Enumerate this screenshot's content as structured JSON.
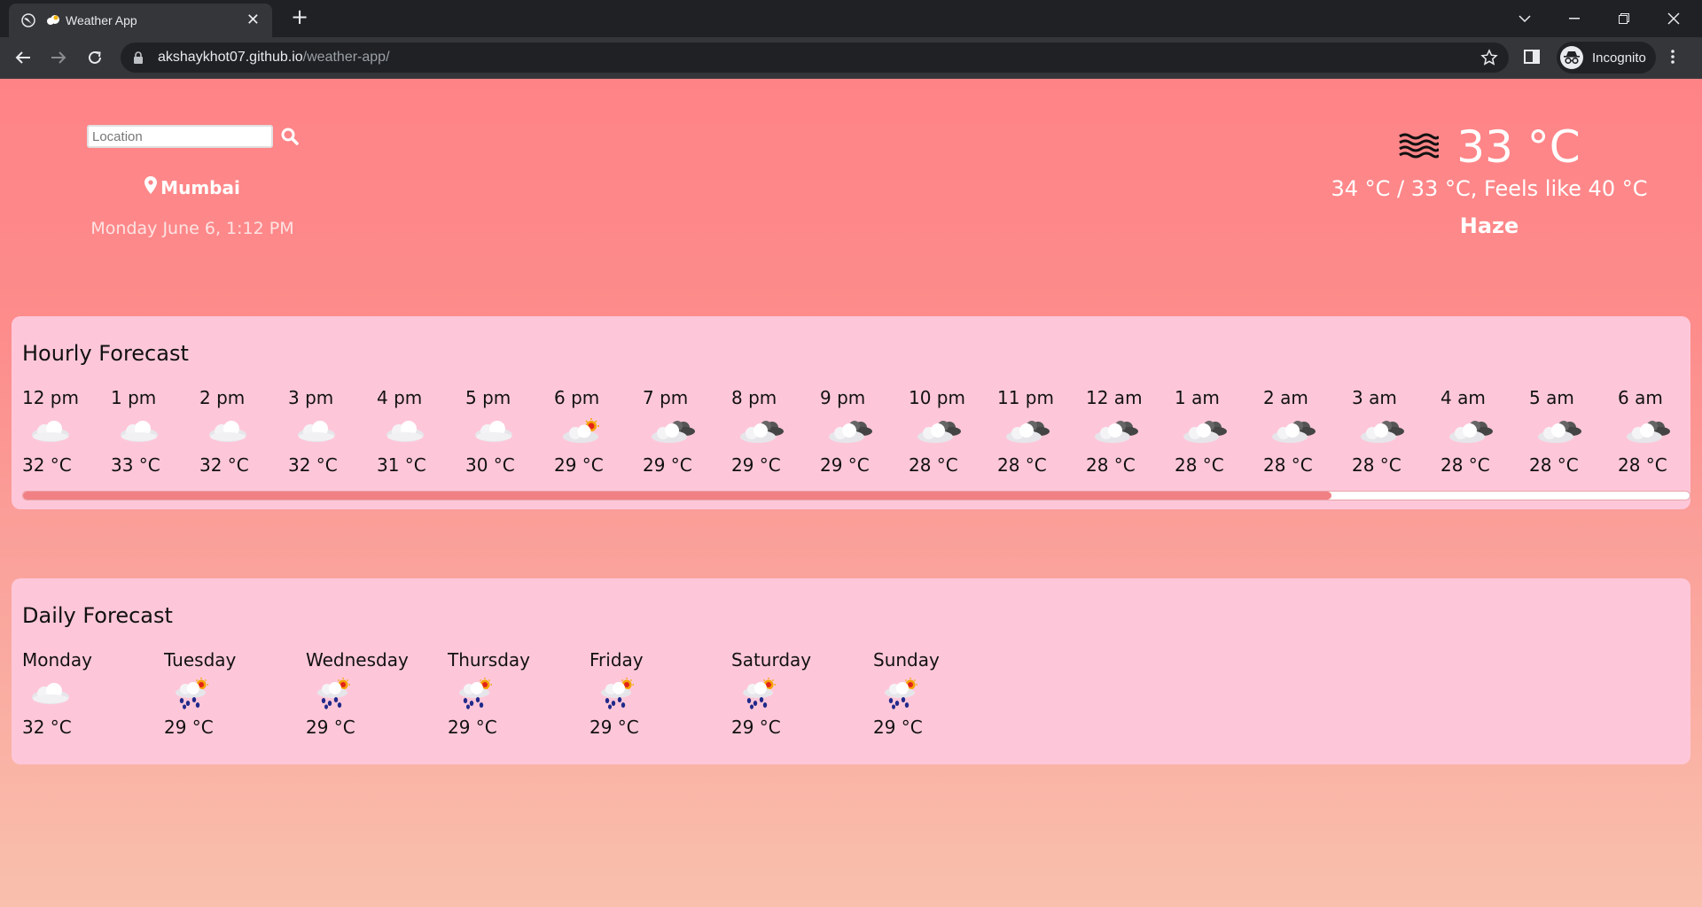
{
  "browser": {
    "tab_title": "Weather App",
    "url_host": "akshaykhot07.github.io",
    "url_path": "/weather-app/",
    "profile_label": "Incognito"
  },
  "search": {
    "placeholder": "Location",
    "value": ""
  },
  "location": {
    "city": "Mumbai",
    "datetime": "Monday June 6, 1:12 PM"
  },
  "current": {
    "temp": "33 °C",
    "range": "34 °C / 33 °C, Feels like 40 °C",
    "condition": "Haze",
    "icon": "haze-icon"
  },
  "hourly": {
    "title": "Hourly Forecast",
    "items": [
      {
        "time": "12 pm",
        "icon": "cloud",
        "temp": "32 °C"
      },
      {
        "time": "1 pm",
        "icon": "cloud",
        "temp": "33 °C"
      },
      {
        "time": "2 pm",
        "icon": "cloud",
        "temp": "32 °C"
      },
      {
        "time": "3 pm",
        "icon": "cloud",
        "temp": "32 °C"
      },
      {
        "time": "4 pm",
        "icon": "cloud",
        "temp": "31 °C"
      },
      {
        "time": "5 pm",
        "icon": "cloud",
        "temp": "30 °C"
      },
      {
        "time": "6 pm",
        "icon": "sun-cloud",
        "temp": "29 °C"
      },
      {
        "time": "7 pm",
        "icon": "dark-cloud",
        "temp": "29 °C"
      },
      {
        "time": "8 pm",
        "icon": "dark-cloud",
        "temp": "29 °C"
      },
      {
        "time": "9 pm",
        "icon": "dark-cloud",
        "temp": "29 °C"
      },
      {
        "time": "10 pm",
        "icon": "dark-cloud",
        "temp": "28 °C"
      },
      {
        "time": "11 pm",
        "icon": "dark-cloud",
        "temp": "28 °C"
      },
      {
        "time": "12 am",
        "icon": "dark-cloud",
        "temp": "28 °C"
      },
      {
        "time": "1 am",
        "icon": "dark-cloud",
        "temp": "28 °C"
      },
      {
        "time": "2 am",
        "icon": "dark-cloud",
        "temp": "28 °C"
      },
      {
        "time": "3 am",
        "icon": "dark-cloud",
        "temp": "28 °C"
      },
      {
        "time": "4 am",
        "icon": "dark-cloud",
        "temp": "28 °C"
      },
      {
        "time": "5 am",
        "icon": "dark-cloud",
        "temp": "28 °C"
      },
      {
        "time": "6 am",
        "icon": "dark-cloud",
        "temp": "28 °C"
      }
    ]
  },
  "daily": {
    "title": "Daily Forecast",
    "items": [
      {
        "day": "Monday",
        "icon": "cloud",
        "temp": "32 °C"
      },
      {
        "day": "Tuesday",
        "icon": "rain-sun",
        "temp": "29 °C"
      },
      {
        "day": "Wednesday",
        "icon": "rain-sun",
        "temp": "29 °C"
      },
      {
        "day": "Thursday",
        "icon": "rain-sun",
        "temp": "29 °C"
      },
      {
        "day": "Friday",
        "icon": "rain-sun",
        "temp": "29 °C"
      },
      {
        "day": "Saturday",
        "icon": "rain-sun",
        "temp": "29 °C"
      },
      {
        "day": "Sunday",
        "icon": "rain-sun",
        "temp": "29 °C"
      }
    ]
  },
  "colors": {
    "page_top": "#fe8387",
    "page_bottom": "#f9c0ad",
    "panel": "#fec7d9",
    "scroll_thumb": "#f18084"
  }
}
